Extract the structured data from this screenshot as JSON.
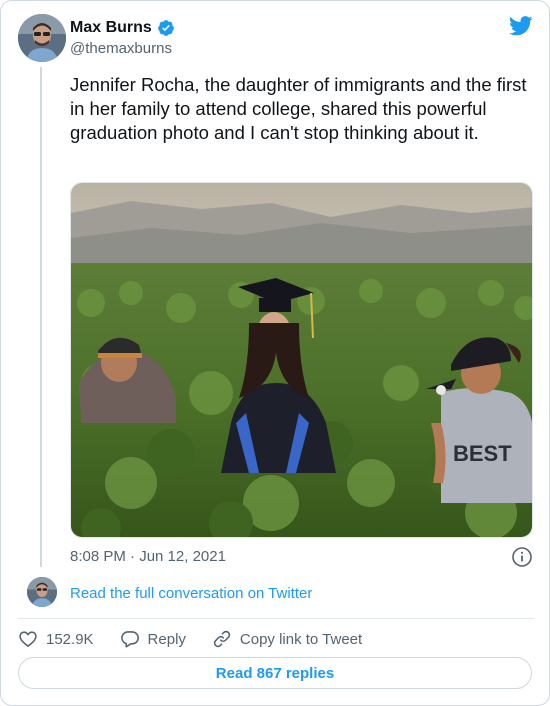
{
  "author": {
    "name": "Max Burns",
    "handle": "@themaxburns",
    "verified": true
  },
  "tweet": {
    "text": "Jennifer Rocha, the daughter of immigrants and the first in her family to attend college, shared this powerful graduation photo and I can't stop thinking about it.",
    "timestamp": "8:08 PM · Jun 12, 2021"
  },
  "conversation_link": "Read the full conversation on Twitter",
  "actions": {
    "likes": "152.9K",
    "reply": "Reply",
    "copy_link": "Copy link to Tweet"
  },
  "read_replies": "Read 867 replies",
  "colors": {
    "accent": "#1d9bf0",
    "text": "#0f1419",
    "secondary": "#536471",
    "border": "#cfd9de"
  },
  "icons": [
    "twitter-bird-icon",
    "verified-badge-icon",
    "info-icon",
    "heart-icon",
    "reply-icon",
    "link-icon"
  ]
}
